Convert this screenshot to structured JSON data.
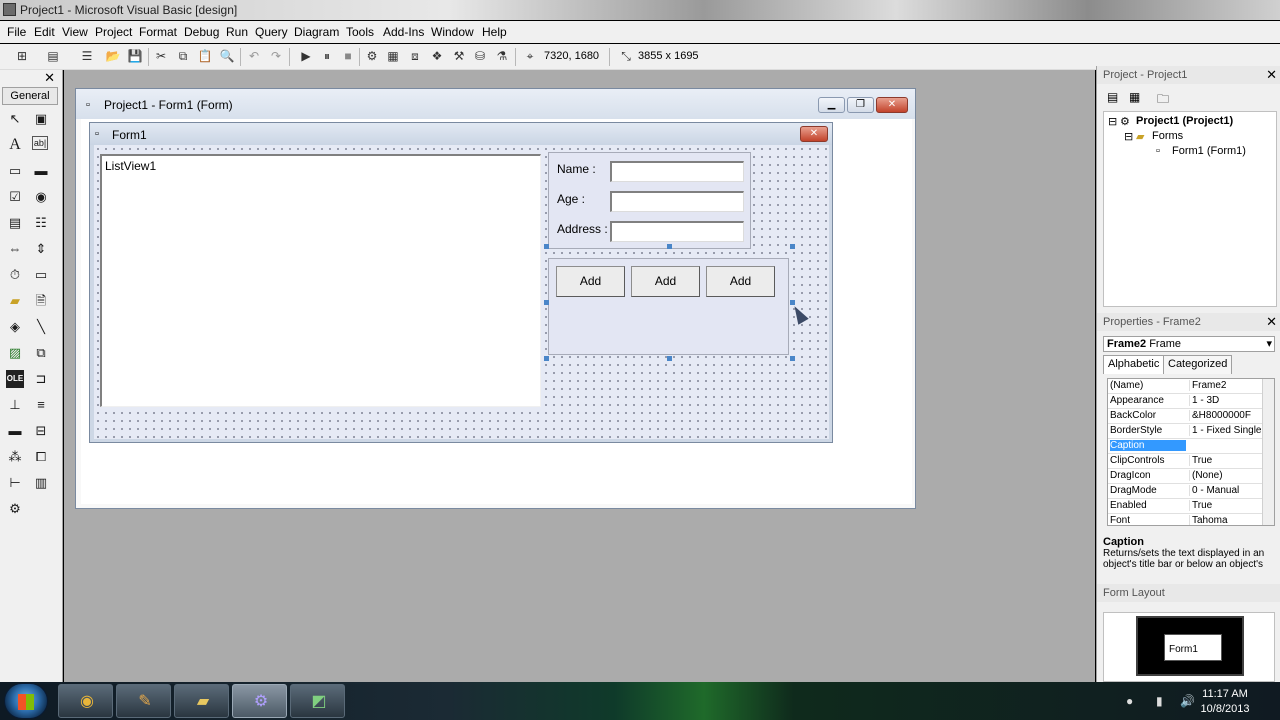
{
  "window_title": "Project1 - Microsoft Visual Basic [design]",
  "menu": [
    "File",
    "Edit",
    "View",
    "Project",
    "Format",
    "Debug",
    "Run",
    "Query",
    "Diagram",
    "Tools",
    "Add-Ins",
    "Window",
    "Help"
  ],
  "toolbar": {
    "position_readout": "7320, 1680",
    "size_readout": "3855 x 1695"
  },
  "toolbox": {
    "header": "General",
    "close": "✕"
  },
  "designer": {
    "title": "Project1 - Form1 (Form)",
    "form_caption": "Form1",
    "listview_caption": "ListView1",
    "labels": {
      "name": "Name :",
      "age": "Age :",
      "address": "Address :"
    },
    "buttons": [
      "Add",
      "Add",
      "Add"
    ]
  },
  "project_panel": {
    "title": "Project - Project1",
    "tree": {
      "project": "Project1 (Project1)",
      "folder": "Forms",
      "form": "Form1 (Form1)"
    }
  },
  "properties_panel": {
    "title": "Properties - Frame2",
    "object_bold": "Frame2",
    "object_type": "Frame",
    "tabs": [
      "Alphabetic",
      "Categorized"
    ],
    "rows": [
      {
        "name": "(Name)",
        "value": "Frame2"
      },
      {
        "name": "Appearance",
        "value": "1 - 3D"
      },
      {
        "name": "BackColor",
        "value": "&H8000000F"
      },
      {
        "name": "BorderStyle",
        "value": "1 - Fixed Single"
      },
      {
        "name": "Caption",
        "value": ""
      },
      {
        "name": "ClipControls",
        "value": "True"
      },
      {
        "name": "DragIcon",
        "value": "(None)"
      },
      {
        "name": "DragMode",
        "value": "0 - Manual"
      },
      {
        "name": "Enabled",
        "value": "True"
      },
      {
        "name": "Font",
        "value": "Tahoma"
      }
    ],
    "selected_property": "Caption",
    "description_title": "Caption",
    "description_text": "Returns/sets the text displayed in an object's title bar or below an object's"
  },
  "form_layout": {
    "title": "Form Layout",
    "form_label": "Form1"
  },
  "taskbar": {
    "time": "11:17 AM",
    "date": "10/8/2013"
  }
}
